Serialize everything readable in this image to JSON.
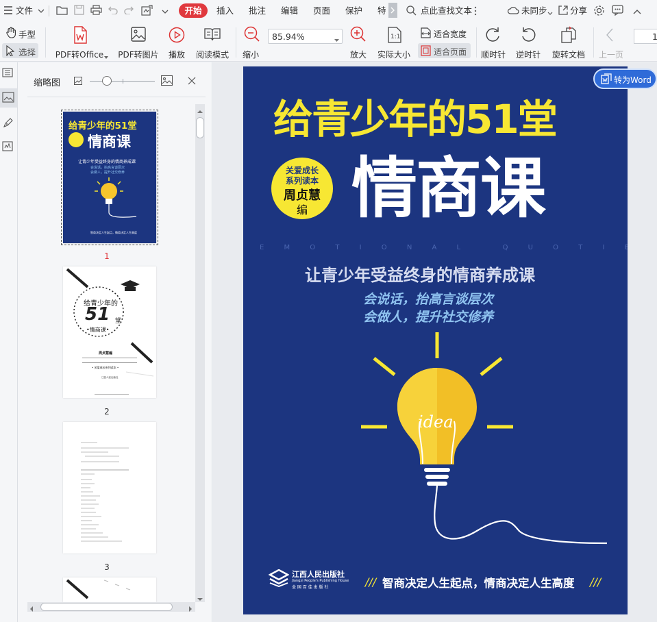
{
  "menu": {
    "file": "文件",
    "start": "开始",
    "insert": "插入",
    "annotate": "批注",
    "edit": "编辑",
    "page": "页面",
    "protect": "保护",
    "special": "特",
    "search_placeholder": "点此查找文本",
    "sync": "未同步",
    "share": "分享"
  },
  "toolbar": {
    "hand": "手型",
    "select": "选择",
    "pdf_to_office": "PDF转Office",
    "pdf_to_image": "PDF转图片",
    "play": "播放",
    "read_mode": "阅读模式",
    "zoom_out": "缩小",
    "zoom_value": "85.94%",
    "zoom_in": "放大",
    "actual_size": "实际大小",
    "fit_width": "适合宽度",
    "fit_page": "适合页面",
    "rotate_cw": "顺时针",
    "rotate_ccw": "逆时针",
    "rotate_doc": "旋转文档",
    "prev_page": "上一页",
    "page_input": "1"
  },
  "thumbnails": {
    "title": "缩略图",
    "pages": [
      {
        "number": "1"
      },
      {
        "number": "2"
      },
      {
        "number": "3"
      }
    ]
  },
  "convert_button": "转为Word",
  "cover": {
    "title_line1": "给青少年的51堂",
    "title_line2": "情商课",
    "badge_line1": "关爱成长",
    "badge_line2": "系列读本",
    "badge_author": "周贞慧",
    "badge_role": "编",
    "eq_caption": "E M O T I O N A L   Q U O T I E N T",
    "subtitle": "让青少年受益终身的情商养成课",
    "tagline1": "会说话，抬高言谈层次",
    "tagline2": "会做人，提升社交修养",
    "bulb_text": "idea",
    "publisher_cn": "江西人民出版社",
    "publisher_en": "Jiangxi People's Publishing House",
    "publisher_sub": "全 国 百 佳 出 版 社",
    "slogan": "智商决定人生起点，情商决定人生高度"
  },
  "thumb2": {
    "title1": "给青少年的",
    "num": "51",
    "hall": "堂",
    "title2": "•情商课•",
    "author": "周贞慧编",
    "series": "• 关爱成长系列读本 •",
    "publisher": "江西人民出版社"
  },
  "colors": {
    "accent_red": "#e0393e",
    "cover_blue": "#1c3580",
    "cover_yellow": "#f7e733",
    "convert_blue": "#2f6bd8"
  }
}
